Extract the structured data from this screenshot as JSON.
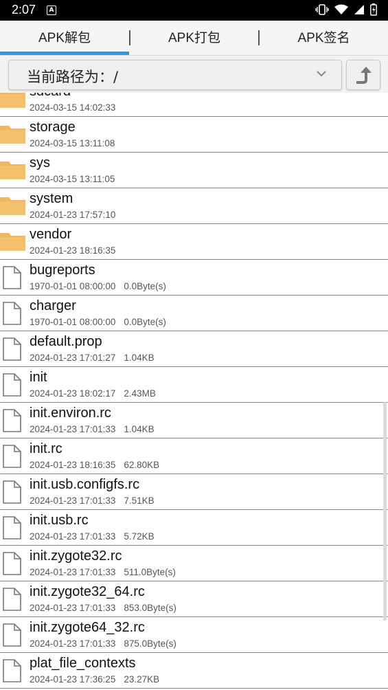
{
  "status_bar": {
    "time": "2:07",
    "notification_letter": "A"
  },
  "tabs": [
    {
      "label": "APK解包",
      "selected": true
    },
    {
      "label": "APK打包",
      "selected": false
    },
    {
      "label": "APK签名",
      "selected": false
    }
  ],
  "path_bar": {
    "label": "当前路径为：/"
  },
  "colors": {
    "accent": "#2b9ae0",
    "folder": "#f0b85c"
  },
  "files": [
    {
      "name": "sdcard",
      "date": "2024-03-15 14:02:33",
      "size": "",
      "type": "folder"
    },
    {
      "name": "storage",
      "date": "2024-03-15 13:11:08",
      "size": "",
      "type": "folder"
    },
    {
      "name": "sys",
      "date": "2024-03-15 13:11:05",
      "size": "",
      "type": "folder"
    },
    {
      "name": "system",
      "date": "2024-01-23 17:57:10",
      "size": "",
      "type": "folder"
    },
    {
      "name": "vendor",
      "date": "2024-01-23 18:16:35",
      "size": "",
      "type": "folder"
    },
    {
      "name": "bugreports",
      "date": "1970-01-01 08:00:00",
      "size": "0.0Byte(s)",
      "type": "file"
    },
    {
      "name": "charger",
      "date": "1970-01-01 08:00:00",
      "size": "0.0Byte(s)",
      "type": "file"
    },
    {
      "name": "default.prop",
      "date": "2024-01-23 17:01:27",
      "size": "1.04KB",
      "type": "file"
    },
    {
      "name": "init",
      "date": "2024-01-23 18:02:17",
      "size": "2.43MB",
      "type": "file"
    },
    {
      "name": "init.environ.rc",
      "date": "2024-01-23 17:01:33",
      "size": "1.04KB",
      "type": "file"
    },
    {
      "name": "init.rc",
      "date": "2024-01-23 18:16:35",
      "size": "62.80KB",
      "type": "file"
    },
    {
      "name": "init.usb.configfs.rc",
      "date": "2024-01-23 17:01:33",
      "size": "7.51KB",
      "type": "file"
    },
    {
      "name": "init.usb.rc",
      "date": "2024-01-23 17:01:33",
      "size": "5.72KB",
      "type": "file"
    },
    {
      "name": "init.zygote32.rc",
      "date": "2024-01-23 17:01:33",
      "size": "511.0Byte(s)",
      "type": "file"
    },
    {
      "name": "init.zygote32_64.rc",
      "date": "2024-01-23 17:01:33",
      "size": "853.0Byte(s)",
      "type": "file"
    },
    {
      "name": "init.zygote64_32.rc",
      "date": "2024-01-23 17:01:33",
      "size": "875.0Byte(s)",
      "type": "file"
    },
    {
      "name": "plat_file_contexts",
      "date": "2024-01-23 17:36:25",
      "size": "23.27KB",
      "type": "file"
    }
  ]
}
